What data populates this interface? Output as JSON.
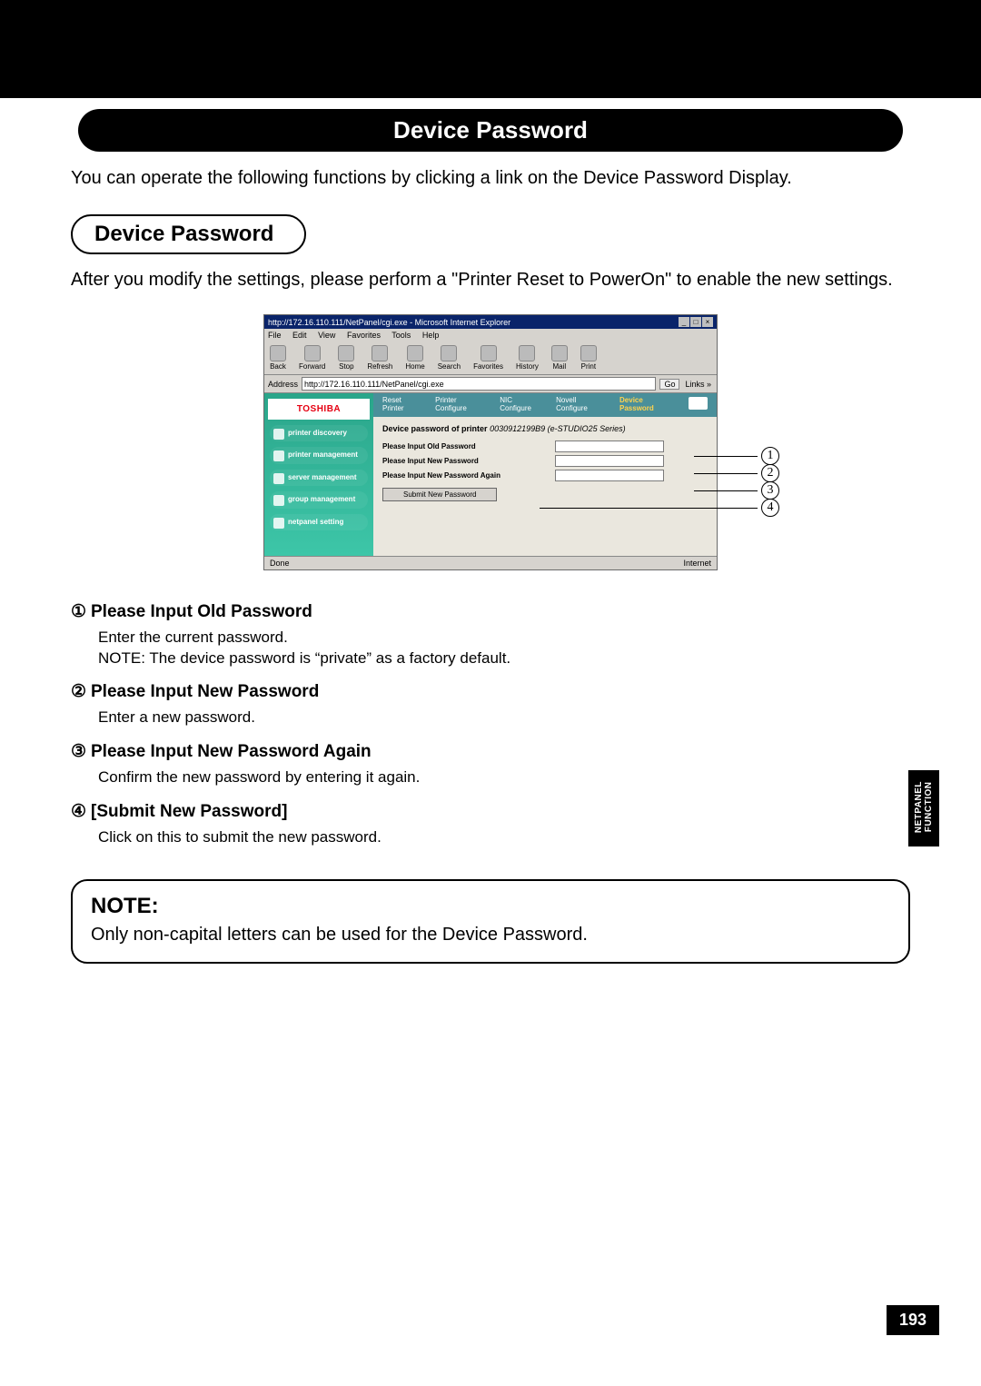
{
  "header_title": "Device Password",
  "intro_text": "You can operate the following functions by clicking a link on the Device Password Display.",
  "sub_header": "Device Password",
  "sub_text": "After you modify the settings, please perform a \"Printer Reset to PowerOn\" to enable the new settings.",
  "screenshot": {
    "window_title": "http://172.16.110.111/NetPanel/cgi.exe - Microsoft Internet Explorer",
    "menu": {
      "file": "File",
      "edit": "Edit",
      "view": "View",
      "favorites": "Favorites",
      "tools": "Tools",
      "help": "Help"
    },
    "toolbar": {
      "back": "Back",
      "forward": "Forward",
      "stop": "Stop",
      "refresh": "Refresh",
      "home": "Home",
      "search": "Search",
      "favorites": "Favorites",
      "history": "History",
      "mail": "Mail",
      "print": "Print"
    },
    "address_label": "Address",
    "address_value": "http://172.16.110.111/NetPanel/cgi.exe",
    "go_label": "Go",
    "links_label": "Links »",
    "brand": "TOSHIBA",
    "sidebar": [
      "printer discovery",
      "printer management",
      "server management",
      "group management",
      "netpanel setting"
    ],
    "tabs": {
      "reset": "Reset Printer",
      "printer": "Printer Configure",
      "nic": "NIC Configure",
      "novell": "Novell Configure",
      "device": "Device Password"
    },
    "panel_heading_prefix": "Device password of printer",
    "panel_heading_id": "0030912199B9 (e-STUDIO25 Series)",
    "form": {
      "old": "Please Input Old Password",
      "new": "Please Input New Password",
      "again": "Please Input New Password Again",
      "submit": "Submit New Password"
    },
    "status_done": "Done",
    "status_zone": "Internet"
  },
  "callout_numbers": {
    "one": "1",
    "two": "2",
    "three": "3",
    "four": "4"
  },
  "items": [
    {
      "marker": "①",
      "title": "Please Input Old Password",
      "body": "Enter the current password.\nNOTE: The device password is “private” as a factory default."
    },
    {
      "marker": "②",
      "title": "Please Input New Password",
      "body": "Enter a new password."
    },
    {
      "marker": "③",
      "title": "Please Input New Password Again",
      "body": "Confirm the new password by entering it again."
    },
    {
      "marker": "④",
      "title": "[Submit New Password]",
      "body": "Click on this to submit the new password."
    }
  ],
  "note": {
    "heading": "NOTE:",
    "body": "Only non-capital letters can be used for the Device Password."
  },
  "side_tab": {
    "line1": "NETPANEL",
    "line2": "FUNCTION"
  },
  "page_number": "193"
}
